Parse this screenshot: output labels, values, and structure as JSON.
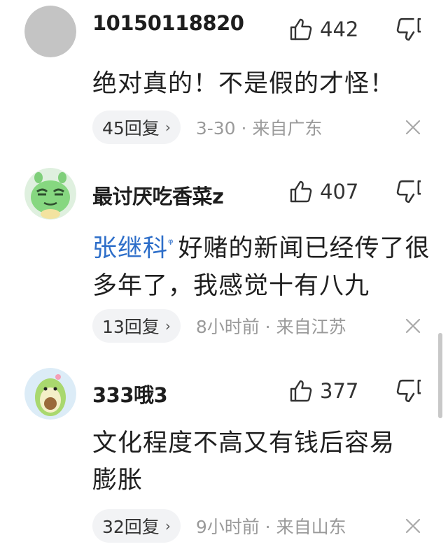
{
  "comments": [
    {
      "username": "10150118820",
      "likes": "442",
      "text": "绝对真的！不是假的才怪！",
      "replies": "45回复",
      "time": "3-30",
      "location": "来自广东"
    },
    {
      "username": "最讨厌吃香菜z",
      "likes": "407",
      "mention": "张继科",
      "text": "好赌的新闻已经传了很多年了，我感觉十有八九",
      "replies": "13回复",
      "time": "8小时前",
      "location": "来自江苏"
    },
    {
      "username": "333哦3",
      "likes": "377",
      "text": "文化程度不高又有钱后容易膨胀",
      "replies": "32回复",
      "time": "9小时前",
      "location": "来自山东"
    }
  ],
  "separator": " · ",
  "icons": {
    "like": "thumbs-up-icon",
    "dislike": "thumbs-down-icon",
    "close": "close-icon",
    "mention": "search-icon",
    "reply_chevron": "chevron-right-icon"
  },
  "colors": {
    "mention": "#2d6ec9",
    "meta": "#9a9a9a",
    "pill_bg": "#f2f3f5"
  }
}
